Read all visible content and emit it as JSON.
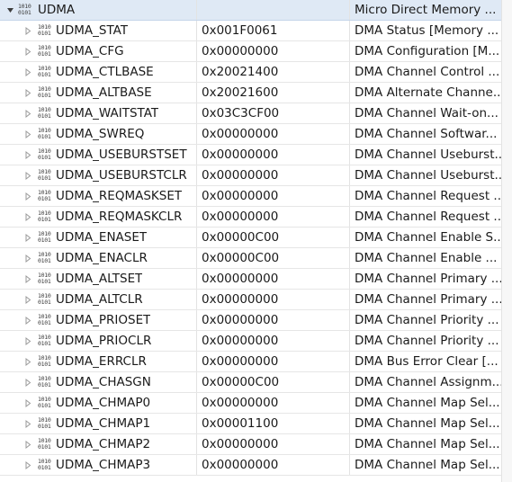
{
  "group": {
    "name": "UDMA",
    "description": "Micro Direct Memory ..."
  },
  "registers": [
    {
      "name": "UDMA_STAT",
      "value": "0x001F0061",
      "description": "DMA Status [Memory ..."
    },
    {
      "name": "UDMA_CFG",
      "value": "0x00000000",
      "description": "DMA Configuration [M..."
    },
    {
      "name": "UDMA_CTLBASE",
      "value": "0x20021400",
      "description": "DMA Channel Control ..."
    },
    {
      "name": "UDMA_ALTBASE",
      "value": "0x20021600",
      "description": "DMA Alternate Channe..."
    },
    {
      "name": "UDMA_WAITSTAT",
      "value": "0x03C3CF00",
      "description": "DMA Channel Wait-on..."
    },
    {
      "name": "UDMA_SWREQ",
      "value": "0x00000000",
      "description": "DMA Channel Softwar..."
    },
    {
      "name": "UDMA_USEBURSTSET",
      "value": "0x00000000",
      "description": "DMA Channel Useburst..."
    },
    {
      "name": "UDMA_USEBURSTCLR",
      "value": "0x00000000",
      "description": "DMA Channel Useburst..."
    },
    {
      "name": "UDMA_REQMASKSET",
      "value": "0x00000000",
      "description": "DMA Channel Request ..."
    },
    {
      "name": "UDMA_REQMASKCLR",
      "value": "0x00000000",
      "description": "DMA Channel Request ..."
    },
    {
      "name": "UDMA_ENASET",
      "value": "0x00000C00",
      "description": "DMA Channel Enable S..."
    },
    {
      "name": "UDMA_ENACLR",
      "value": "0x00000C00",
      "description": "DMA Channel Enable ..."
    },
    {
      "name": "UDMA_ALTSET",
      "value": "0x00000000",
      "description": "DMA Channel Primary ..."
    },
    {
      "name": "UDMA_ALTCLR",
      "value": "0x00000000",
      "description": "DMA Channel Primary ..."
    },
    {
      "name": "UDMA_PRIOSET",
      "value": "0x00000000",
      "description": "DMA Channel Priority ..."
    },
    {
      "name": "UDMA_PRIOCLR",
      "value": "0x00000000",
      "description": "DMA Channel Priority ..."
    },
    {
      "name": "UDMA_ERRCLR",
      "value": "0x00000000",
      "description": "DMA Bus Error Clear [..."
    },
    {
      "name": "UDMA_CHASGN",
      "value": "0x00000C00",
      "description": "DMA Channel Assignm..."
    },
    {
      "name": "UDMA_CHMAP0",
      "value": "0x00000000",
      "description": "DMA Channel Map Sel..."
    },
    {
      "name": "UDMA_CHMAP1",
      "value": "0x00001100",
      "description": "DMA Channel Map Sel..."
    },
    {
      "name": "UDMA_CHMAP2",
      "value": "0x00000000",
      "description": "DMA Channel Map Sel..."
    },
    {
      "name": "UDMA_CHMAP3",
      "value": "0x00000000",
      "description": "DMA Channel Map Sel..."
    }
  ],
  "icons": {
    "expand": "chevron-down-icon",
    "collapsed": "chevron-right-icon",
    "register": "register-bits-icon"
  },
  "colors": {
    "selection": "#dfe9f5",
    "gridline": "#e6e6e6",
    "twisty": "#a0a0a0"
  }
}
